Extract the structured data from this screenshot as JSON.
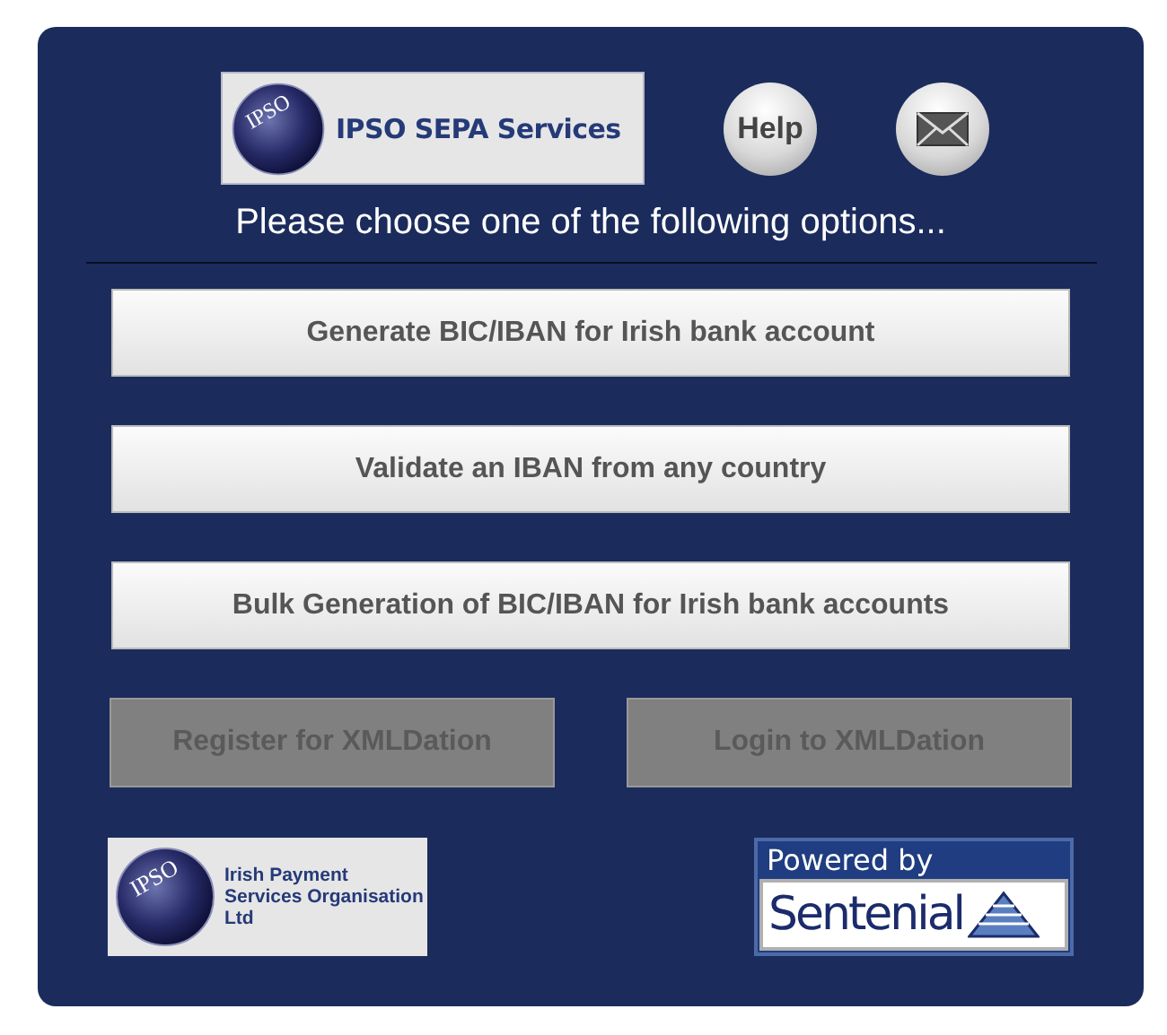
{
  "header": {
    "logo_mark": "IPSO",
    "logo_title": "IPSO SEPA Services",
    "help_label": "Help"
  },
  "prompt": "Please choose one of the following options...",
  "options": [
    {
      "label": "Generate BIC/IBAN for Irish bank account",
      "disabled": false
    },
    {
      "label": "Validate an IBAN from any country",
      "disabled": false
    },
    {
      "label": "Bulk Generation of BIC/IBAN for Irish bank accounts",
      "disabled": false
    }
  ],
  "xmldation_buttons": [
    {
      "label": "Register for XMLDation",
      "disabled": true
    },
    {
      "label": "Login to XMLDation",
      "disabled": true
    }
  ],
  "footer": {
    "ipso_mark": "IPSO",
    "ipso_name": "Irish Payment Services Organisation Ltd",
    "powered_by": "Powered by",
    "sentenial": "Sentenial"
  }
}
